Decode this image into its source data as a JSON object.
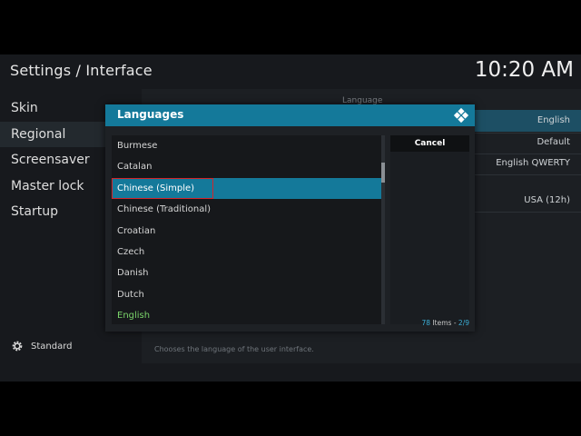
{
  "header": {
    "title": "Settings / Interface",
    "clock": "10:20 AM"
  },
  "sidebar": {
    "items": [
      {
        "label": "Skin"
      },
      {
        "label": "Regional"
      },
      {
        "label": "Screensaver"
      },
      {
        "label": "Master lock"
      },
      {
        "label": "Startup"
      }
    ],
    "footer_label": "Standard"
  },
  "settings_panel": {
    "section_label": "Language",
    "rows": [
      {
        "value": "English"
      },
      {
        "value": "Default"
      },
      {
        "value": "English QWERTY"
      },
      {
        "value": "USA (12h)"
      }
    ],
    "status_text": "Chooses the language of the user interface."
  },
  "dialog": {
    "title": "Languages",
    "items": [
      {
        "label": "Burmese"
      },
      {
        "label": "Catalan"
      },
      {
        "label": "Chinese (Simple)"
      },
      {
        "label": "Chinese (Traditional)"
      },
      {
        "label": "Croatian"
      },
      {
        "label": "Czech"
      },
      {
        "label": "Danish"
      },
      {
        "label": "Dutch"
      },
      {
        "label": "English"
      }
    ],
    "selected_index": 2,
    "current_index": 8,
    "cancel_label": "Cancel",
    "items_count": "78",
    "items_word": "Items",
    "page": "2/9"
  },
  "colors": {
    "accent": "#14799a",
    "highlight_box": "#d2252b",
    "current_item": "#7ad46a"
  },
  "icons": {
    "logo": "kodi-icon",
    "footer": "gear-icon"
  }
}
